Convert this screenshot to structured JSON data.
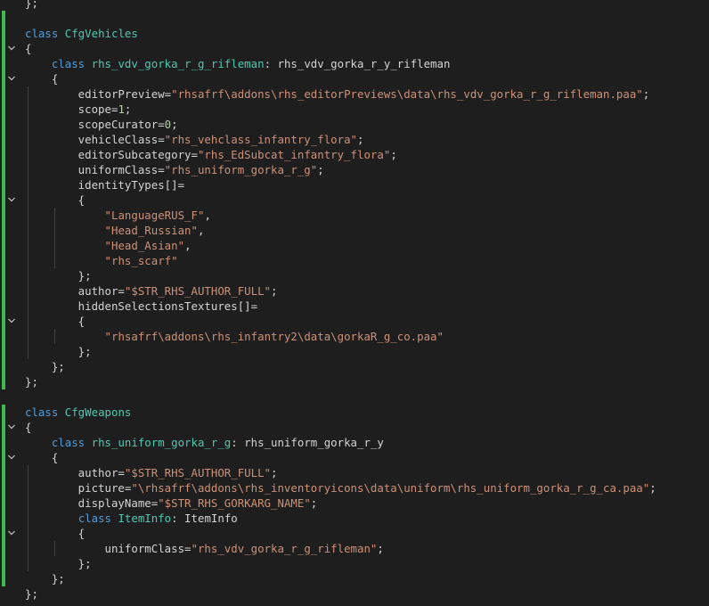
{
  "editor": {
    "lines": [
      {
        "tokens": [
          {
            "t": "};",
            "c": "plain"
          }
        ],
        "fold": "",
        "mod": false
      },
      {
        "tokens": [],
        "fold": "",
        "mod": true
      },
      {
        "tokens": [
          {
            "t": "class ",
            "c": "kw"
          },
          {
            "t": "CfgVehicles",
            "c": "cls"
          }
        ],
        "fold": "",
        "mod": true
      },
      {
        "tokens": [
          {
            "t": "{",
            "c": "plain"
          }
        ],
        "fold": "v",
        "mod": true
      },
      {
        "tokens": [
          {
            "t": "    "
          },
          {
            "t": "class ",
            "c": "kw"
          },
          {
            "t": "rhs_vdv_gorka_r_g_rifleman",
            "c": "cls"
          },
          {
            "t": ": rhs_vdv_gorka_r_y_rifleman",
            "c": "plain"
          }
        ],
        "fold": "",
        "mod": true
      },
      {
        "tokens": [
          {
            "t": "    {",
            "c": "plain"
          }
        ],
        "fold": "v",
        "mod": true
      },
      {
        "tokens": [
          {
            "t": "        editorPreview=",
            "c": "plain"
          },
          {
            "t": "\"rhsafrf\\addons\\rhs_editorPreviews\\data\\rhs_vdv_gorka_r_g_rifleman.paa\"",
            "c": "str"
          },
          {
            "t": ";",
            "c": "plain"
          }
        ],
        "fold": "",
        "mod": true
      },
      {
        "tokens": [
          {
            "t": "        scope=",
            "c": "plain"
          },
          {
            "t": "1",
            "c": "num"
          },
          {
            "t": ";",
            "c": "plain"
          }
        ],
        "fold": "",
        "mod": true
      },
      {
        "tokens": [
          {
            "t": "        scopeCurator=",
            "c": "plain"
          },
          {
            "t": "0",
            "c": "num"
          },
          {
            "t": ";",
            "c": "plain"
          }
        ],
        "fold": "",
        "mod": true
      },
      {
        "tokens": [
          {
            "t": "        vehicleClass=",
            "c": "plain"
          },
          {
            "t": "\"rhs_vehclass_infantry_flora\"",
            "c": "str"
          },
          {
            "t": ";",
            "c": "plain"
          }
        ],
        "fold": "",
        "mod": true
      },
      {
        "tokens": [
          {
            "t": "        editorSubcategory=",
            "c": "plain"
          },
          {
            "t": "\"rhs_EdSubcat_infantry_flora\"",
            "c": "str"
          },
          {
            "t": ";",
            "c": "plain"
          }
        ],
        "fold": "",
        "mod": true
      },
      {
        "tokens": [
          {
            "t": "        uniformClass=",
            "c": "plain"
          },
          {
            "t": "\"rhs_uniform_gorka_r_g\"",
            "c": "str"
          },
          {
            "t": ";",
            "c": "plain"
          }
        ],
        "fold": "",
        "mod": true
      },
      {
        "tokens": [
          {
            "t": "        identityTypes[]=",
            "c": "plain"
          }
        ],
        "fold": "",
        "mod": true
      },
      {
        "tokens": [
          {
            "t": "        {",
            "c": "plain"
          }
        ],
        "fold": "v",
        "mod": true
      },
      {
        "tokens": [
          {
            "t": "            "
          },
          {
            "t": "\"LanguageRUS_F\"",
            "c": "str"
          },
          {
            "t": ",",
            "c": "plain"
          }
        ],
        "fold": "",
        "mod": true
      },
      {
        "tokens": [
          {
            "t": "            "
          },
          {
            "t": "\"Head_Russian\"",
            "c": "str"
          },
          {
            "t": ",",
            "c": "plain"
          }
        ],
        "fold": "",
        "mod": true
      },
      {
        "tokens": [
          {
            "t": "            "
          },
          {
            "t": "\"Head_Asian\"",
            "c": "str"
          },
          {
            "t": ",",
            "c": "plain"
          }
        ],
        "fold": "",
        "mod": true
      },
      {
        "tokens": [
          {
            "t": "            "
          },
          {
            "t": "\"rhs_scarf\"",
            "c": "str"
          }
        ],
        "fold": "",
        "mod": true
      },
      {
        "tokens": [
          {
            "t": "        };",
            "c": "plain"
          }
        ],
        "fold": "",
        "mod": true
      },
      {
        "tokens": [
          {
            "t": "        author=",
            "c": "plain"
          },
          {
            "t": "\"$STR_RHS_AUTHOR_FULL\"",
            "c": "str"
          },
          {
            "t": ";",
            "c": "plain"
          }
        ],
        "fold": "",
        "mod": true
      },
      {
        "tokens": [
          {
            "t": "        hiddenSelectionsTextures[]=",
            "c": "plain"
          }
        ],
        "fold": "",
        "mod": true
      },
      {
        "tokens": [
          {
            "t": "        {",
            "c": "plain"
          }
        ],
        "fold": "v",
        "mod": true
      },
      {
        "tokens": [
          {
            "t": "            "
          },
          {
            "t": "\"rhsafrf\\addons\\rhs_infantry2\\data\\gorkaR_g_co.paa\"",
            "c": "str"
          }
        ],
        "fold": "",
        "mod": true
      },
      {
        "tokens": [
          {
            "t": "        };",
            "c": "plain"
          }
        ],
        "fold": "",
        "mod": true
      },
      {
        "tokens": [
          {
            "t": "    };",
            "c": "plain"
          }
        ],
        "fold": "",
        "mod": true
      },
      {
        "tokens": [
          {
            "t": "};",
            "c": "plain"
          }
        ],
        "fold": "",
        "mod": true
      },
      {
        "tokens": [],
        "fold": "",
        "mod": false
      },
      {
        "tokens": [
          {
            "t": "class ",
            "c": "kw"
          },
          {
            "t": "CfgWeapons",
            "c": "cls"
          }
        ],
        "fold": "",
        "mod": true
      },
      {
        "tokens": [
          {
            "t": "{",
            "c": "plain"
          }
        ],
        "fold": "v",
        "mod": true
      },
      {
        "tokens": [
          {
            "t": "    "
          },
          {
            "t": "class ",
            "c": "kw"
          },
          {
            "t": "rhs_uniform_gorka_r_g",
            "c": "cls"
          },
          {
            "t": ": rhs_uniform_gorka_r_y",
            "c": "plain"
          }
        ],
        "fold": "",
        "mod": true
      },
      {
        "tokens": [
          {
            "t": "    {",
            "c": "plain"
          }
        ],
        "fold": "v",
        "mod": true
      },
      {
        "tokens": [
          {
            "t": "        author=",
            "c": "plain"
          },
          {
            "t": "\"$STR_RHS_AUTHOR_FULL\"",
            "c": "str"
          },
          {
            "t": ";",
            "c": "plain"
          }
        ],
        "fold": "",
        "mod": true
      },
      {
        "tokens": [
          {
            "t": "        picture=",
            "c": "plain"
          },
          {
            "t": "\"\\rhsafrf\\addons\\rhs_inventoryicons\\data\\uniform\\rhs_uniform_gorka_r_g_ca.paa\"",
            "c": "str"
          },
          {
            "t": ";",
            "c": "plain"
          }
        ],
        "fold": "",
        "mod": true
      },
      {
        "tokens": [
          {
            "t": "        displayName=",
            "c": "plain"
          },
          {
            "t": "\"$STR_RHS_GORKARG_NAME\"",
            "c": "str"
          },
          {
            "t": ";",
            "c": "plain"
          }
        ],
        "fold": "",
        "mod": true
      },
      {
        "tokens": [
          {
            "t": "        "
          },
          {
            "t": "class ",
            "c": "kw"
          },
          {
            "t": "ItemInfo",
            "c": "cls"
          },
          {
            "t": ": ItemInfo",
            "c": "plain"
          }
        ],
        "fold": "",
        "mod": true
      },
      {
        "tokens": [
          {
            "t": "        {",
            "c": "plain"
          }
        ],
        "fold": "v",
        "mod": true
      },
      {
        "tokens": [
          {
            "t": "            uniformClass=",
            "c": "plain"
          },
          {
            "t": "\"rhs_vdv_gorka_r_g_rifleman\"",
            "c": "str"
          },
          {
            "t": ";",
            "c": "plain"
          }
        ],
        "fold": "",
        "mod": true
      },
      {
        "tokens": [
          {
            "t": "        };",
            "c": "plain"
          }
        ],
        "fold": "",
        "mod": true
      },
      {
        "tokens": [
          {
            "t": "    };",
            "c": "plain"
          }
        ],
        "fold": "",
        "mod": true
      },
      {
        "tokens": [
          {
            "t": "};",
            "c": "plain"
          }
        ],
        "fold": "",
        "mod": false
      }
    ]
  },
  "colors": {
    "background": "#1e1e1e",
    "keyword": "#569cd6",
    "class_name": "#4ec9b0",
    "string": "#ce9178",
    "number": "#b5cea8",
    "text": "#d4d4d4",
    "modified_gutter": "#3fb950"
  },
  "icons": {
    "fold": "chevron-down-icon"
  }
}
